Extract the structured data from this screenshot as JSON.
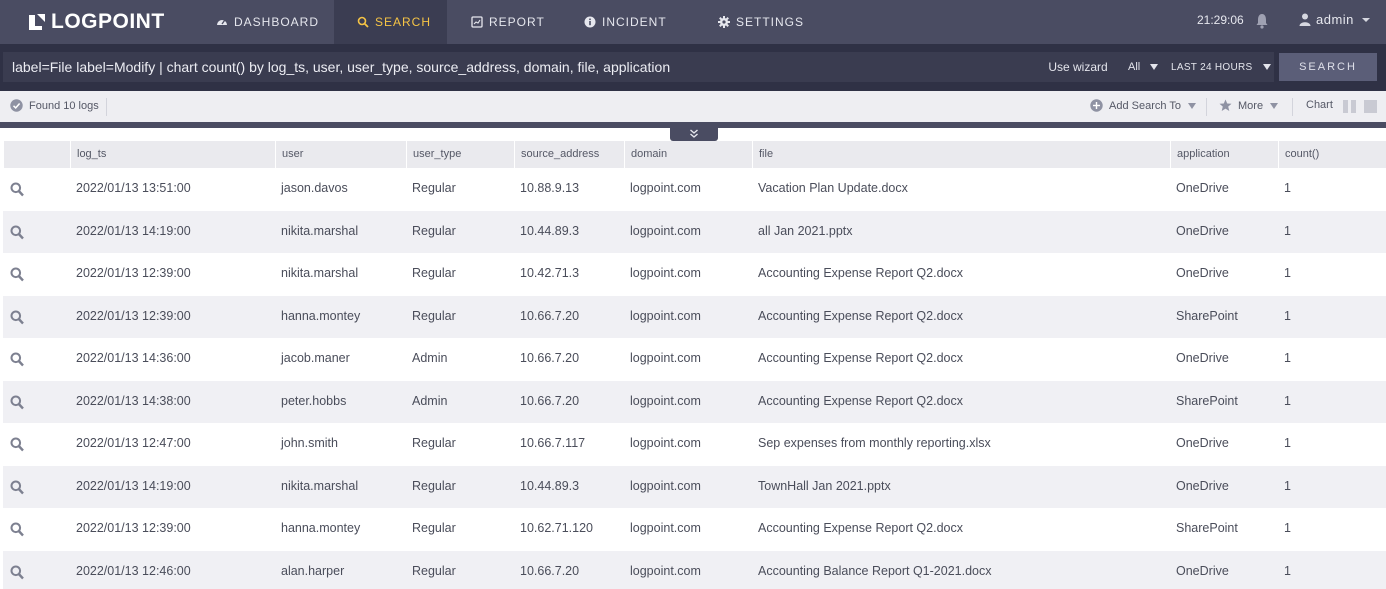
{
  "app": {
    "logo_text": "LOGPOINT"
  },
  "nav": {
    "items": [
      {
        "label": "DASHBOARD",
        "icon": "gauge-icon"
      },
      {
        "label": "SEARCH",
        "icon": "search-icon",
        "active": true
      },
      {
        "label": "REPORT",
        "icon": "report-icon"
      },
      {
        "label": "INCIDENT",
        "icon": "info-icon"
      },
      {
        "label": "SETTINGS",
        "icon": "gear-icon"
      }
    ],
    "clock": "21:29:06",
    "user": "admin"
  },
  "query": {
    "text": "label=File label=Modify | chart count() by log_ts, user, user_type, source_address, domain, file, application",
    "use_wizard": "Use wizard",
    "repo": "All",
    "time_range": "LAST 24 HOURS",
    "search_button": "SEARCH"
  },
  "status": {
    "found": "Found 10 logs",
    "add_search_to": "Add Search To",
    "more": "More",
    "chart": "Chart"
  },
  "colors": {
    "nav_bg": "#4a4c62",
    "query_bg": "#2f3145",
    "accent": "#f6c445"
  },
  "table": {
    "columns": [
      "",
      "log_ts",
      "user",
      "user_type",
      "source_address",
      "domain",
      "file",
      "application",
      "count()"
    ],
    "rows": [
      [
        "2022/01/13 13:51:00",
        "jason.davos",
        "Regular",
        "10.88.9.13",
        "logpoint.com",
        "Vacation Plan Update.docx",
        "OneDrive",
        "1"
      ],
      [
        "2022/01/13 14:19:00",
        "nikita.marshal",
        "Regular",
        "10.44.89.3",
        "logpoint.com",
        "all Jan 2021.pptx",
        "OneDrive",
        "1"
      ],
      [
        "2022/01/13 12:39:00",
        "nikita.marshal",
        "Regular",
        "10.42.71.3",
        "logpoint.com",
        "Accounting Expense Report Q2.docx",
        "OneDrive",
        "1"
      ],
      [
        "2022/01/13 12:39:00",
        "hanna.montey",
        "Regular",
        "10.66.7.20",
        "logpoint.com",
        "Accounting Expense Report Q2.docx",
        "SharePoint",
        "1"
      ],
      [
        "2022/01/13 14:36:00",
        "jacob.maner",
        "Admin",
        "10.66.7.20",
        "logpoint.com",
        "Accounting Expense Report Q2.docx",
        "OneDrive",
        "1"
      ],
      [
        "2022/01/13 14:38:00",
        "peter.hobbs",
        "Admin",
        "10.66.7.20",
        "logpoint.com",
        "Accounting Expense Report Q2.docx",
        "SharePoint",
        "1"
      ],
      [
        "2022/01/13 12:47:00",
        "john.smith",
        "Regular",
        "10.66.7.117",
        "logpoint.com",
        "Sep expenses from monthly reporting.xlsx",
        "OneDrive",
        "1"
      ],
      [
        "2022/01/13 14:19:00",
        "nikita.marshal",
        "Regular",
        "10.44.89.3",
        "logpoint.com",
        "TownHall Jan 2021.pptx",
        "OneDrive",
        "1"
      ],
      [
        "2022/01/13 12:39:00",
        "hanna.montey",
        "Regular",
        "10.62.71.120",
        "logpoint.com",
        "Accounting Expense Report Q2.docx",
        "SharePoint",
        "1"
      ],
      [
        "2022/01/13 12:46:00",
        "alan.harper",
        "Regular",
        "10.66.7.20",
        "logpoint.com",
        "Accounting Balance Report Q1-2021.docx",
        "OneDrive",
        "1"
      ]
    ]
  }
}
